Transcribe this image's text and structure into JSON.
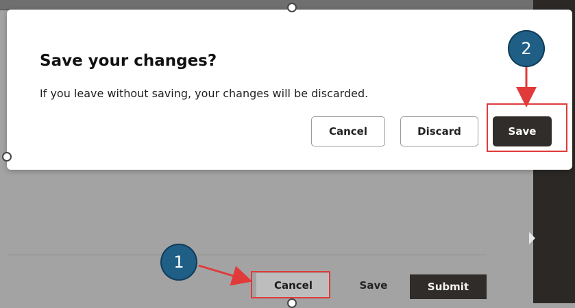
{
  "dialog": {
    "title": "Save your changes?",
    "message": "If you leave without saving, your changes will be discarded.",
    "cancel_label": "Cancel",
    "discard_label": "Discard",
    "save_label": "Save"
  },
  "footer": {
    "cancel_label": "Cancel",
    "save_label": "Save",
    "submit_label": "Submit"
  },
  "annotations": {
    "step1": "1",
    "step2": "2"
  },
  "colors": {
    "highlight": "#e03a3a",
    "step_badge": "#1f5f86",
    "primary_button": "#312d2a"
  }
}
